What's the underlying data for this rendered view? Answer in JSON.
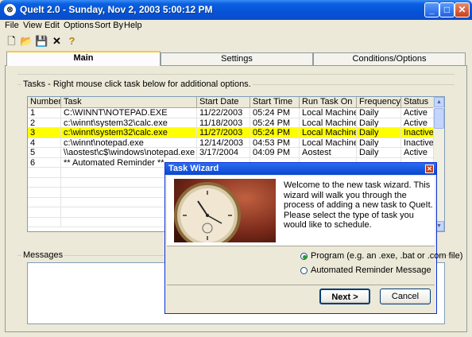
{
  "window": {
    "title": "QueIt 2.0 - Sunday, Nov 2, 2003 5:00:12 PM",
    "minimize": "_",
    "maximize": "□",
    "close": "✕",
    "app_icon": "⊗"
  },
  "menu": [
    "File",
    "View",
    "Edit",
    "Options",
    "Sort By",
    "Help"
  ],
  "toolbar": {
    "icons": [
      "new-document-icon",
      "open-folder-icon",
      "save-icon",
      "delete-icon",
      "help-icon"
    ],
    "glyphs": [
      "🗋",
      "📂",
      "💾",
      "✕",
      "?"
    ]
  },
  "tabs": [
    {
      "label": "Main",
      "active": true
    },
    {
      "label": "Settings",
      "active": false
    },
    {
      "label": "Conditions/Options",
      "active": false
    }
  ],
  "tasks_group_label": "Tasks - Right mouse click task below for additional options.",
  "columns": [
    "Number",
    "Task",
    "Start Date",
    "Start Time",
    "Run Task On",
    "Frequency",
    "Status"
  ],
  "rows": [
    {
      "cells": [
        "1",
        "C:\\WINNT\\NOTEPAD.EXE",
        "11/22/2003",
        "05:24 PM",
        "Local Machine",
        "Daily",
        "Active"
      ],
      "selected": false
    },
    {
      "cells": [
        "2",
        "c:\\winnt\\system32\\calc.exe",
        "11/18/2003",
        "05:24 PM",
        "Local Machine",
        "Daily",
        "Active"
      ],
      "selected": false
    },
    {
      "cells": [
        "3",
        "c:\\winnt\\system32\\calc.exe",
        "11/27/2003",
        "05:24 PM",
        "Local Machine",
        "Daily",
        "Inactive"
      ],
      "selected": true
    },
    {
      "cells": [
        "4",
        "c:\\winnt\\notepad.exe",
        "12/14/2003",
        "04:53 PM",
        "Local Machine",
        "Daily",
        "Inactive"
      ],
      "selected": false
    },
    {
      "cells": [
        "5",
        "\\\\aostest\\c$\\windows\\notepad.exe",
        "3/17/2004",
        "04:09 PM",
        "Aostest",
        "Daily",
        "Active"
      ],
      "selected": false
    },
    {
      "cells": [
        "6",
        "** Automated Reminder **",
        "",
        "",
        "",
        "",
        ""
      ],
      "selected": false
    }
  ],
  "messages_group_label": "Messages",
  "wizard": {
    "title": "Task Wizard",
    "close": "✕",
    "welcome": "Welcome to the new task wizard. This wizard will walk you through the process of adding a new task to QueIt. Please select the type of task you would like to schedule.",
    "options": [
      {
        "label": "Program (e.g. an .exe, .bat or .com file)",
        "selected": true
      },
      {
        "label": "Automated Reminder Message",
        "selected": false
      }
    ],
    "next_label": "Next >",
    "cancel_label": "Cancel"
  },
  "colors": {
    "selected_row": "#FFFF00",
    "titlebar": "#0553D8",
    "tab_highlight": "#FFC83C"
  }
}
